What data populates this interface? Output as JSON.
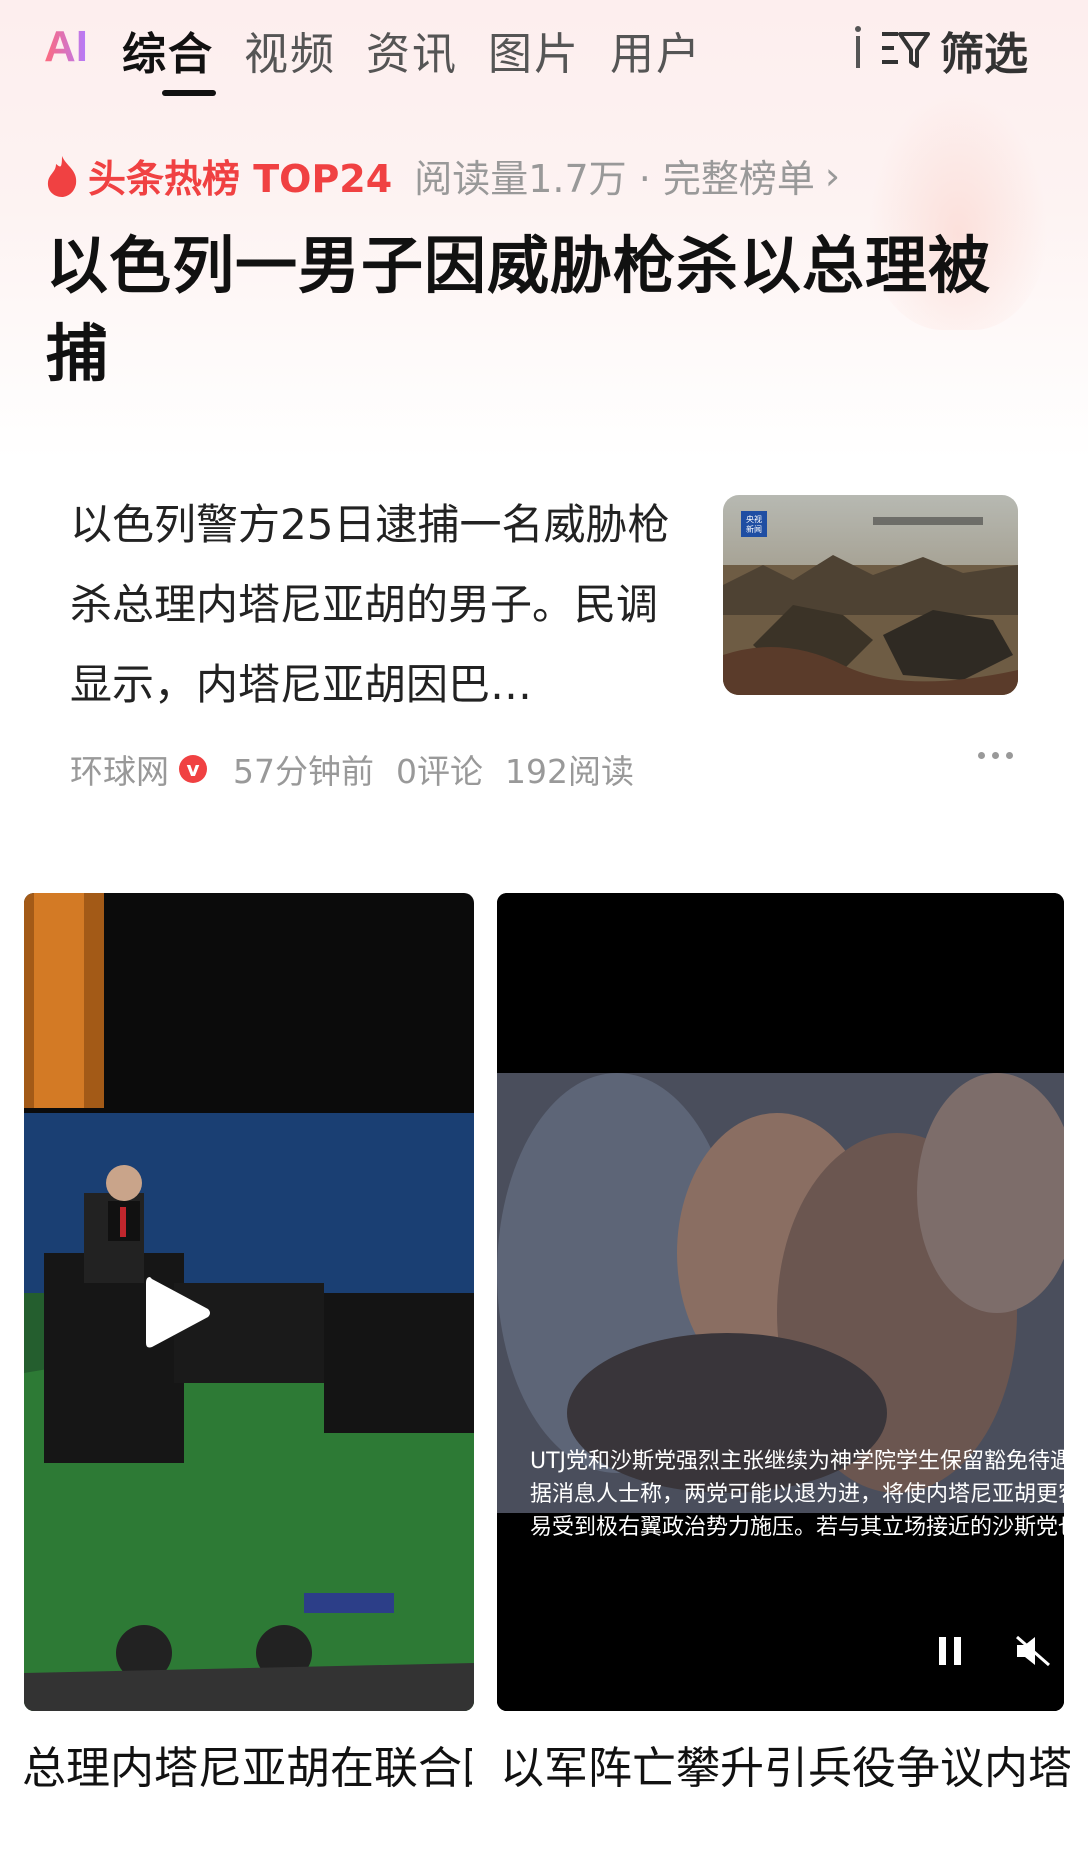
{
  "tabs": {
    "ai": "AI",
    "items": [
      "综合",
      "视频",
      "资讯",
      "图片",
      "用户"
    ],
    "filter_label": "筛选"
  },
  "hot_list": {
    "label": "头条热榜 TOP24",
    "meta": "阅读量1.7万 · 完整榜单",
    "chevron": "›"
  },
  "headline": "以色列一男子因威胁枪杀以总理被捕",
  "article": {
    "summary": "以色列警方25日逮捕一名威胁枪杀总理内塔尼亚胡的男子。民调显示，内塔尼亚胡因巴…",
    "source": "环球网",
    "verified_mark": "v",
    "time": "57分钟前",
    "comments": "0评论",
    "reads": "192阅读",
    "thumb_badge": "央视\n新闻"
  },
  "videos": [
    {
      "title": "总理内塔尼亚胡在联合国大会引发多国官代表离场"
    },
    {
      "title": "以军阵亡攀升引兵役争议内塔尼亚胡政府内乱",
      "caption_lines": [
        "UTJ党和沙斯党强烈主张继续为神学院学生保留豁免待遇。",
        "据消息人士称，两党可能以退为进，将使内塔尼亚胡更容",
        "易受到极右翼政治势力施压。若与其立场接近的沙斯党也"
      ]
    }
  ],
  "colors": {
    "accent": "#f04142",
    "text": "#111111",
    "muted": "#999999"
  }
}
